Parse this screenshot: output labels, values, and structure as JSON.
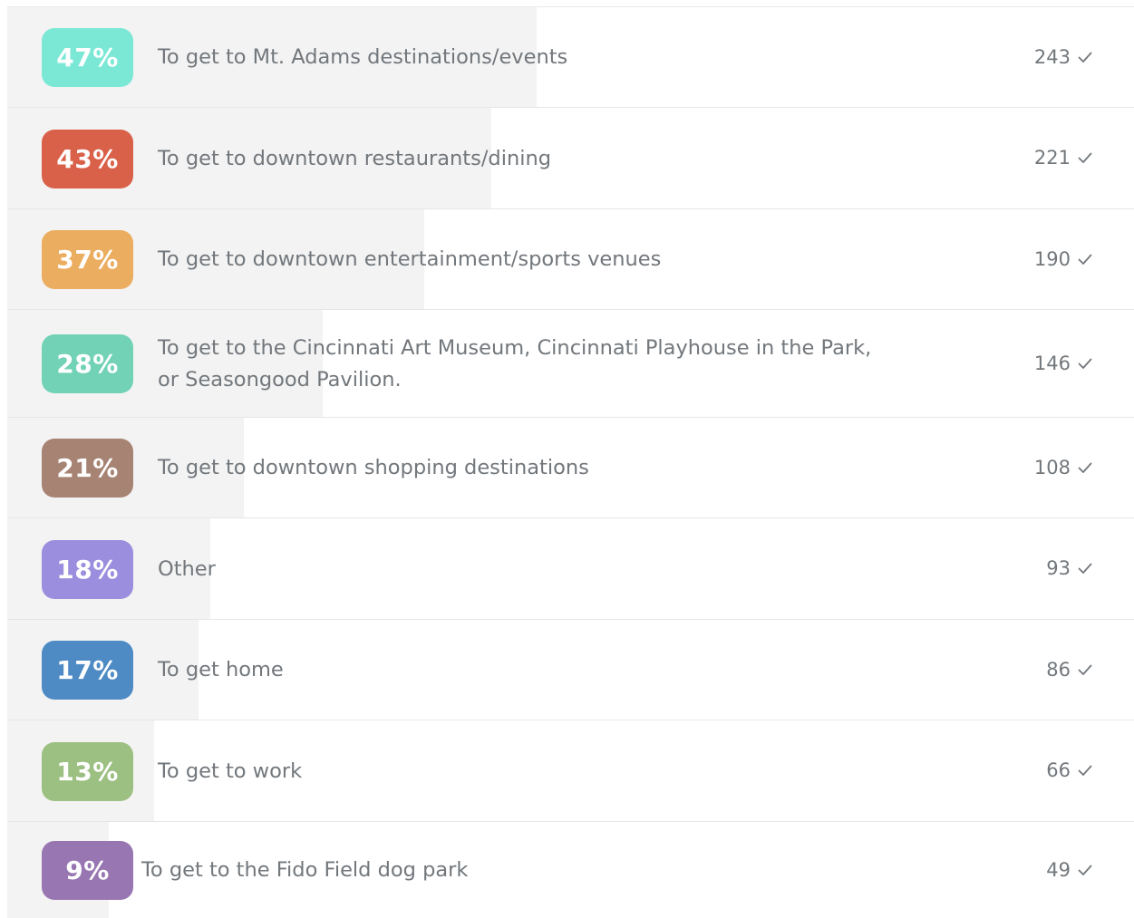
{
  "chart_data": {
    "type": "bar",
    "orientation": "horizontal",
    "grid": false,
    "rows": [
      {
        "percent_label": "47%",
        "percent": 47,
        "label_lines": [
          "To get to Mt. Adams destinations/events"
        ],
        "count": "243",
        "color": "#7be8d6"
      },
      {
        "percent_label": "43%",
        "percent": 43,
        "label_lines": [
          "To get to downtown restaurants/dining"
        ],
        "count": "221",
        "color": "#d96149"
      },
      {
        "percent_label": "37%",
        "percent": 37,
        "label_lines": [
          "To get to downtown entertainment/sports venues"
        ],
        "count": "190",
        "color": "#ebad5f"
      },
      {
        "percent_label": "28%",
        "percent": 28,
        "label_lines": [
          "To get to the Cincinnati Art Museum, Cincinnati Playhouse in the Park,",
          "or Seasongood Pavilion."
        ],
        "count": "146",
        "color": "#72d2b6"
      },
      {
        "percent_label": "21%",
        "percent": 21,
        "label_lines": [
          "To get to downtown shopping destinations"
        ],
        "count": "108",
        "color": "#a68373"
      },
      {
        "percent_label": "18%",
        "percent": 18,
        "label_lines": [
          "Other"
        ],
        "count": "93",
        "color": "#9b8ede"
      },
      {
        "percent_label": "17%",
        "percent": 17,
        "label_lines": [
          "To get home"
        ],
        "count": "86",
        "color": "#4e8bc4"
      },
      {
        "percent_label": "13%",
        "percent": 13,
        "label_lines": [
          "To get to work"
        ],
        "count": "66",
        "color": "#9cbf82"
      },
      {
        "percent_label": "9%",
        "percent": 9,
        "label_lines": [
          "To get to the Fido Field dog park"
        ],
        "count": "49",
        "color": "#9876b2"
      }
    ]
  },
  "icons": {
    "count_check": "checkmark-icon"
  }
}
